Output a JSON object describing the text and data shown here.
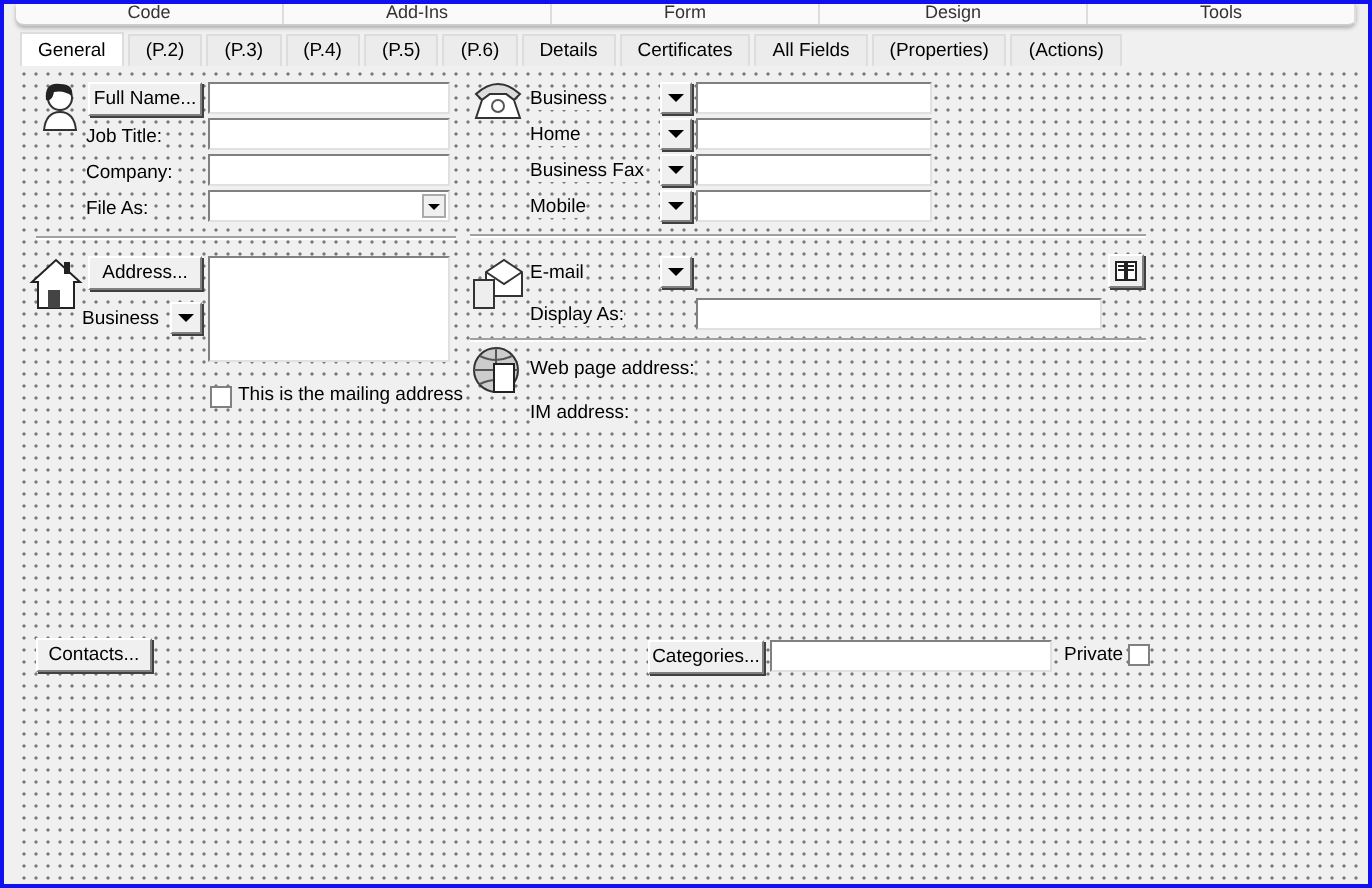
{
  "ribbon_groups": [
    "Code",
    "Add-Ins",
    "Form",
    "Design",
    "Tools"
  ],
  "tabs": [
    {
      "label": "General",
      "selected": true
    },
    {
      "label": "(P.2)",
      "selected": false
    },
    {
      "label": "(P.3)",
      "selected": false
    },
    {
      "label": "(P.4)",
      "selected": false
    },
    {
      "label": "(P.5)",
      "selected": false
    },
    {
      "label": "(P.6)",
      "selected": false
    },
    {
      "label": "Details",
      "selected": false
    },
    {
      "label": "Certificates",
      "selected": false
    },
    {
      "label": "All Fields",
      "selected": false
    },
    {
      "label": "(Properties)",
      "selected": false
    },
    {
      "label": "(Actions)",
      "selected": false
    }
  ],
  "name": {
    "button": "Full Name...",
    "fields": [
      {
        "label": "Job Title:",
        "kind": "text"
      },
      {
        "label": "Company:",
        "kind": "text"
      },
      {
        "label": "File As:",
        "kind": "dropdown"
      }
    ]
  },
  "address": {
    "button": "Address...",
    "type_label": "Business",
    "mailing_checkbox": {
      "label": "This is the mailing address",
      "checked": false
    }
  },
  "phones": [
    {
      "label": "Business"
    },
    {
      "label": "Home"
    },
    {
      "label": "Business Fax"
    },
    {
      "label": "Mobile"
    }
  ],
  "email": {
    "label": "E-mail",
    "display_as": "Display As:"
  },
  "web": {
    "web_page": "Web page address:",
    "im": "IM address:"
  },
  "footer": {
    "contacts_button": "Contacts...",
    "categories_button": "Categories...",
    "private": {
      "label": "Private",
      "checked": false
    }
  }
}
